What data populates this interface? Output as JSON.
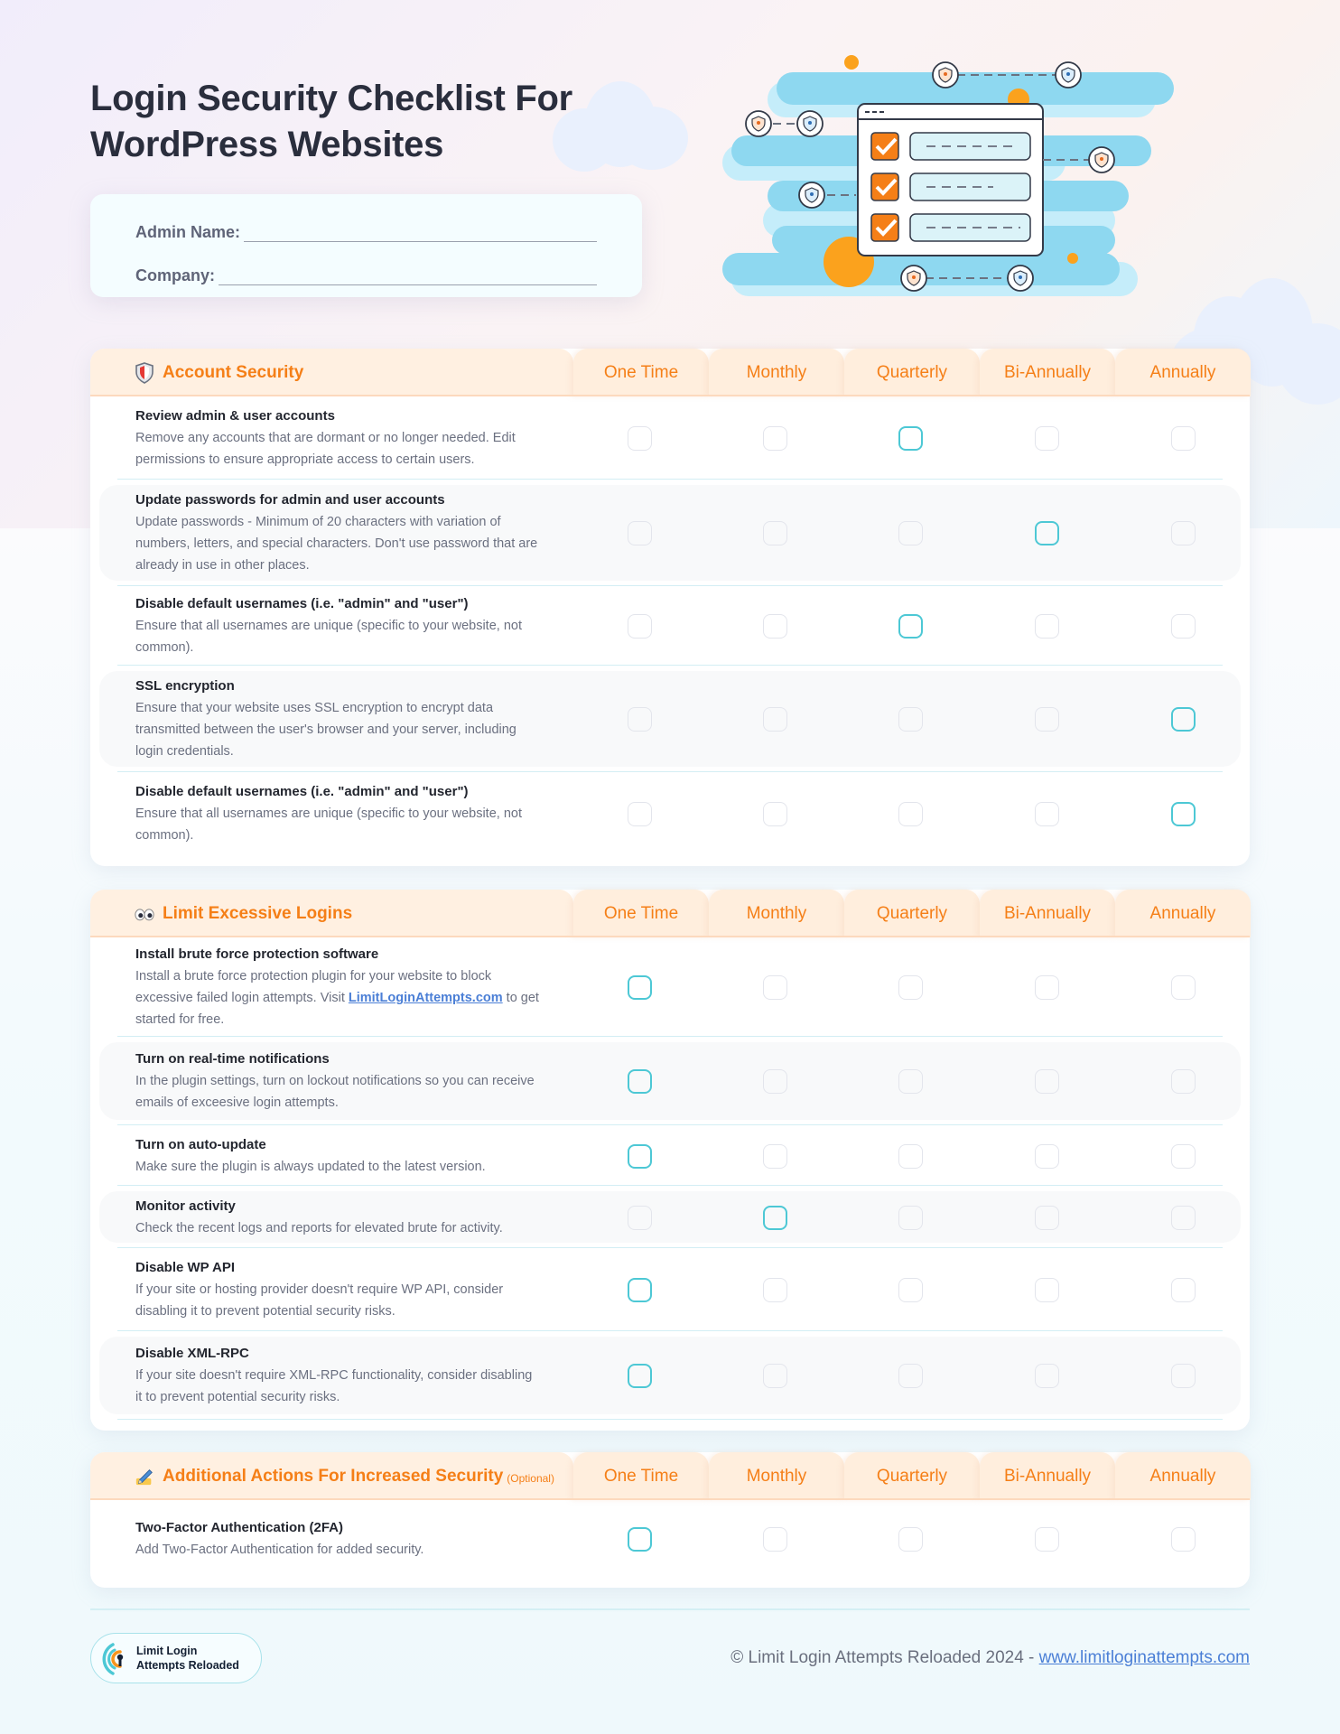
{
  "header": {
    "title_line1": "Login Security Checklist For",
    "title_line2": "WordPress Websites"
  },
  "form": {
    "admin_name_label": "Admin Name:",
    "admin_name_value": "",
    "company_label": "Company:",
    "company_value": ""
  },
  "columns": [
    "One Time",
    "Monthly",
    "Quarterly",
    "Bi-Annually",
    "Annually"
  ],
  "colors": {
    "accent_orange": "#f57f17",
    "header_bg": "#fff0e1",
    "checkbox_highlight": "#4dc8d5",
    "checkbox_default": "#e3e5ec",
    "link": "#4b7fd6"
  },
  "sections": [
    {
      "icon": "shield-icon",
      "title": "Account Security",
      "optional_note": "",
      "items": [
        {
          "title": "Review admin & user accounts",
          "desc": "Remove any accounts that are dormant or no longer needed. Edit permissions to ensure appropriate access to certain users.",
          "highlighted": [
            false,
            false,
            true,
            false,
            false
          ]
        },
        {
          "title": "Update passwords for admin and user accounts",
          "desc": "Update passwords - Minimum of 20 characters with variation of numbers, letters, and special characters. Don't use password that are already in use in other places.",
          "highlighted": [
            false,
            false,
            false,
            true,
            false
          ]
        },
        {
          "title": "Disable default usernames (i.e. \"admin\" and \"user\")",
          "desc": "Ensure that all usernames are unique (specific to your website, not common).",
          "highlighted": [
            false,
            false,
            true,
            false,
            false
          ]
        },
        {
          "title": "SSL encryption",
          "desc": "Ensure that your website uses SSL encryption to encrypt data transmitted between the user's browser and your server, including login credentials.",
          "highlighted": [
            false,
            false,
            false,
            false,
            true
          ]
        },
        {
          "title": "Disable default usernames (i.e. \"admin\" and \"user\")",
          "desc": "Ensure that all usernames are unique (specific to your website, not common).",
          "highlighted": [
            false,
            false,
            false,
            false,
            true
          ]
        }
      ]
    },
    {
      "icon": "eyes-icon",
      "title": "Limit Excessive Logins",
      "optional_note": "",
      "items": [
        {
          "title": "Install brute force protection software",
          "desc_before_link": "Install a brute force protection plugin for your website to block excessive failed login attempts. Visit ",
          "link_text": "LimitLoginAttempts.com",
          "desc_after_link": " to get started for free.",
          "highlighted": [
            true,
            false,
            false,
            false,
            false
          ]
        },
        {
          "title": "Turn on real-time notifications",
          "desc": "In the plugin settings, turn on lockout notifications so you can receive emails of exceesive login attempts.",
          "highlighted": [
            true,
            false,
            false,
            false,
            false
          ]
        },
        {
          "title": "Turn on auto-update",
          "desc": "Make sure the plugin is always updated to the latest version.",
          "highlighted": [
            true,
            false,
            false,
            false,
            false
          ]
        },
        {
          "title": "Monitor activity",
          "desc": "Check the recent logs and reports for elevated brute for activity.",
          "highlighted": [
            false,
            true,
            false,
            false,
            false
          ]
        },
        {
          "title": "Disable WP API",
          "desc": "If your site or hosting provider doesn't require WP API, consider disabling it to prevent potential security risks.",
          "highlighted": [
            true,
            false,
            false,
            false,
            false
          ]
        },
        {
          "title": "Disable XML-RPC",
          "desc": "If your site doesn't require XML-RPC functionality, consider disabling it to prevent potential security risks.",
          "highlighted": [
            true,
            false,
            false,
            false,
            false
          ]
        }
      ]
    },
    {
      "icon": "pencil-writing-icon",
      "title": "Additional Actions For Increased Security",
      "optional_note": "(Optional)",
      "items": [
        {
          "title": "Two-Factor Authentication (2FA)",
          "desc": "Add Two-Factor Authentication for added security.",
          "highlighted": [
            true,
            false,
            false,
            false,
            false
          ]
        }
      ]
    }
  ],
  "footer": {
    "logo_line1": "Limit Login",
    "logo_line2": "Attempts Reloaded",
    "copyright": "© Limit Login Attempts Reloaded 2024 - ",
    "link_text": "www.limitloginattempts.com"
  }
}
